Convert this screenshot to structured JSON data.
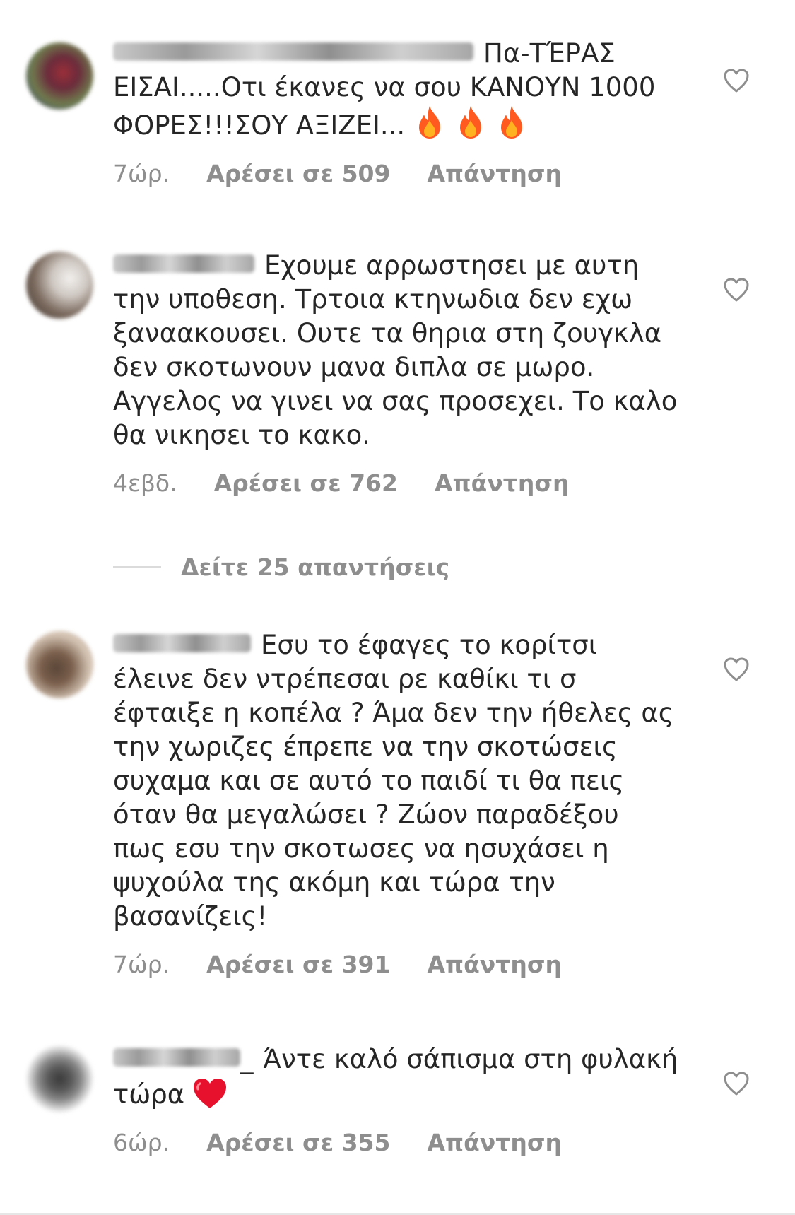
{
  "comments": [
    {
      "text": "Πα-ΤΈΡΑΣ ΕΙΣΑΙ.....Οτι έκανες να σου ΚΑΝΟΥΝ 1000 ΦΟΡΕΣ!!!ΣΟΥ ΑΞΙΖΕΙ...",
      "emoji": "fire-icon x3",
      "time": "7ώρ.",
      "likes": "Αρέσει σε 509",
      "reply": "Απάντηση",
      "avatar_colors": [
        "#6f7b4e",
        "#9b2f3a",
        "#2a3a7a"
      ]
    },
    {
      "text": "Εχουμε αρρωστησει με αυτη την υποθεση. Τρτοια κτηνωδια δεν εχω ξαναακουσει. Ουτε τα θηρια στη ζουγκλα δεν σκοτωνουν μανα διπλα σε μωρο. Αγγελος να γινει να σας προσεχει. Το καλο θα νικησει το κακο.",
      "time": "4εβδ.",
      "likes": "Αρέσει σε 762",
      "reply": "Απάντηση",
      "avatar_colors": [
        "#e8e6e4",
        "#7b6a5e",
        "#3d3530"
      ]
    },
    {
      "text": "Εσυ το έφαγες το κορίτσι έλεινε δεν ντρέπεσαι ρε καθίκι τι σ έφταιξε η κοπέλα ? Άμα δεν την ήθελες ας την χωριζες έπρεπε να την σκοτώσεις συχαμα και σε αυτό το παιδί τι θα πεις όταν θα μεγαλώσει ? Ζώον παραδέξου πως εσυ την σκοτωσες να ησυχάσει η ψυχούλα της ακόμη και τώρα την βασανίζεις!",
      "time": "7ώρ.",
      "likes": "Αρέσει σε 391",
      "reply": "Απάντηση",
      "avatar_colors": [
        "#d8c8b8",
        "#5b4638",
        "#a3866d"
      ]
    },
    {
      "text": "Άντε καλό σάπισμα στη φυλακή τώρα",
      "emoji": "red-heart-icon",
      "username_suffix": "_",
      "time": "6ώρ.",
      "likes": "Αρέσει σε 355",
      "reply": "Απάντηση",
      "avatar_colors": [
        "#f2f2f2",
        "#3a3a3a",
        "#8a8a8a"
      ]
    }
  ],
  "view_replies": "Δείτε 25 απαντήσεις",
  "colors": {
    "text": "#262626",
    "meta": "#8e8e8e",
    "divider": "#dbdbdb",
    "heart_outline": "#8e8e8e",
    "fire": "#ff5a1f",
    "red_heart": "#e8112d"
  }
}
